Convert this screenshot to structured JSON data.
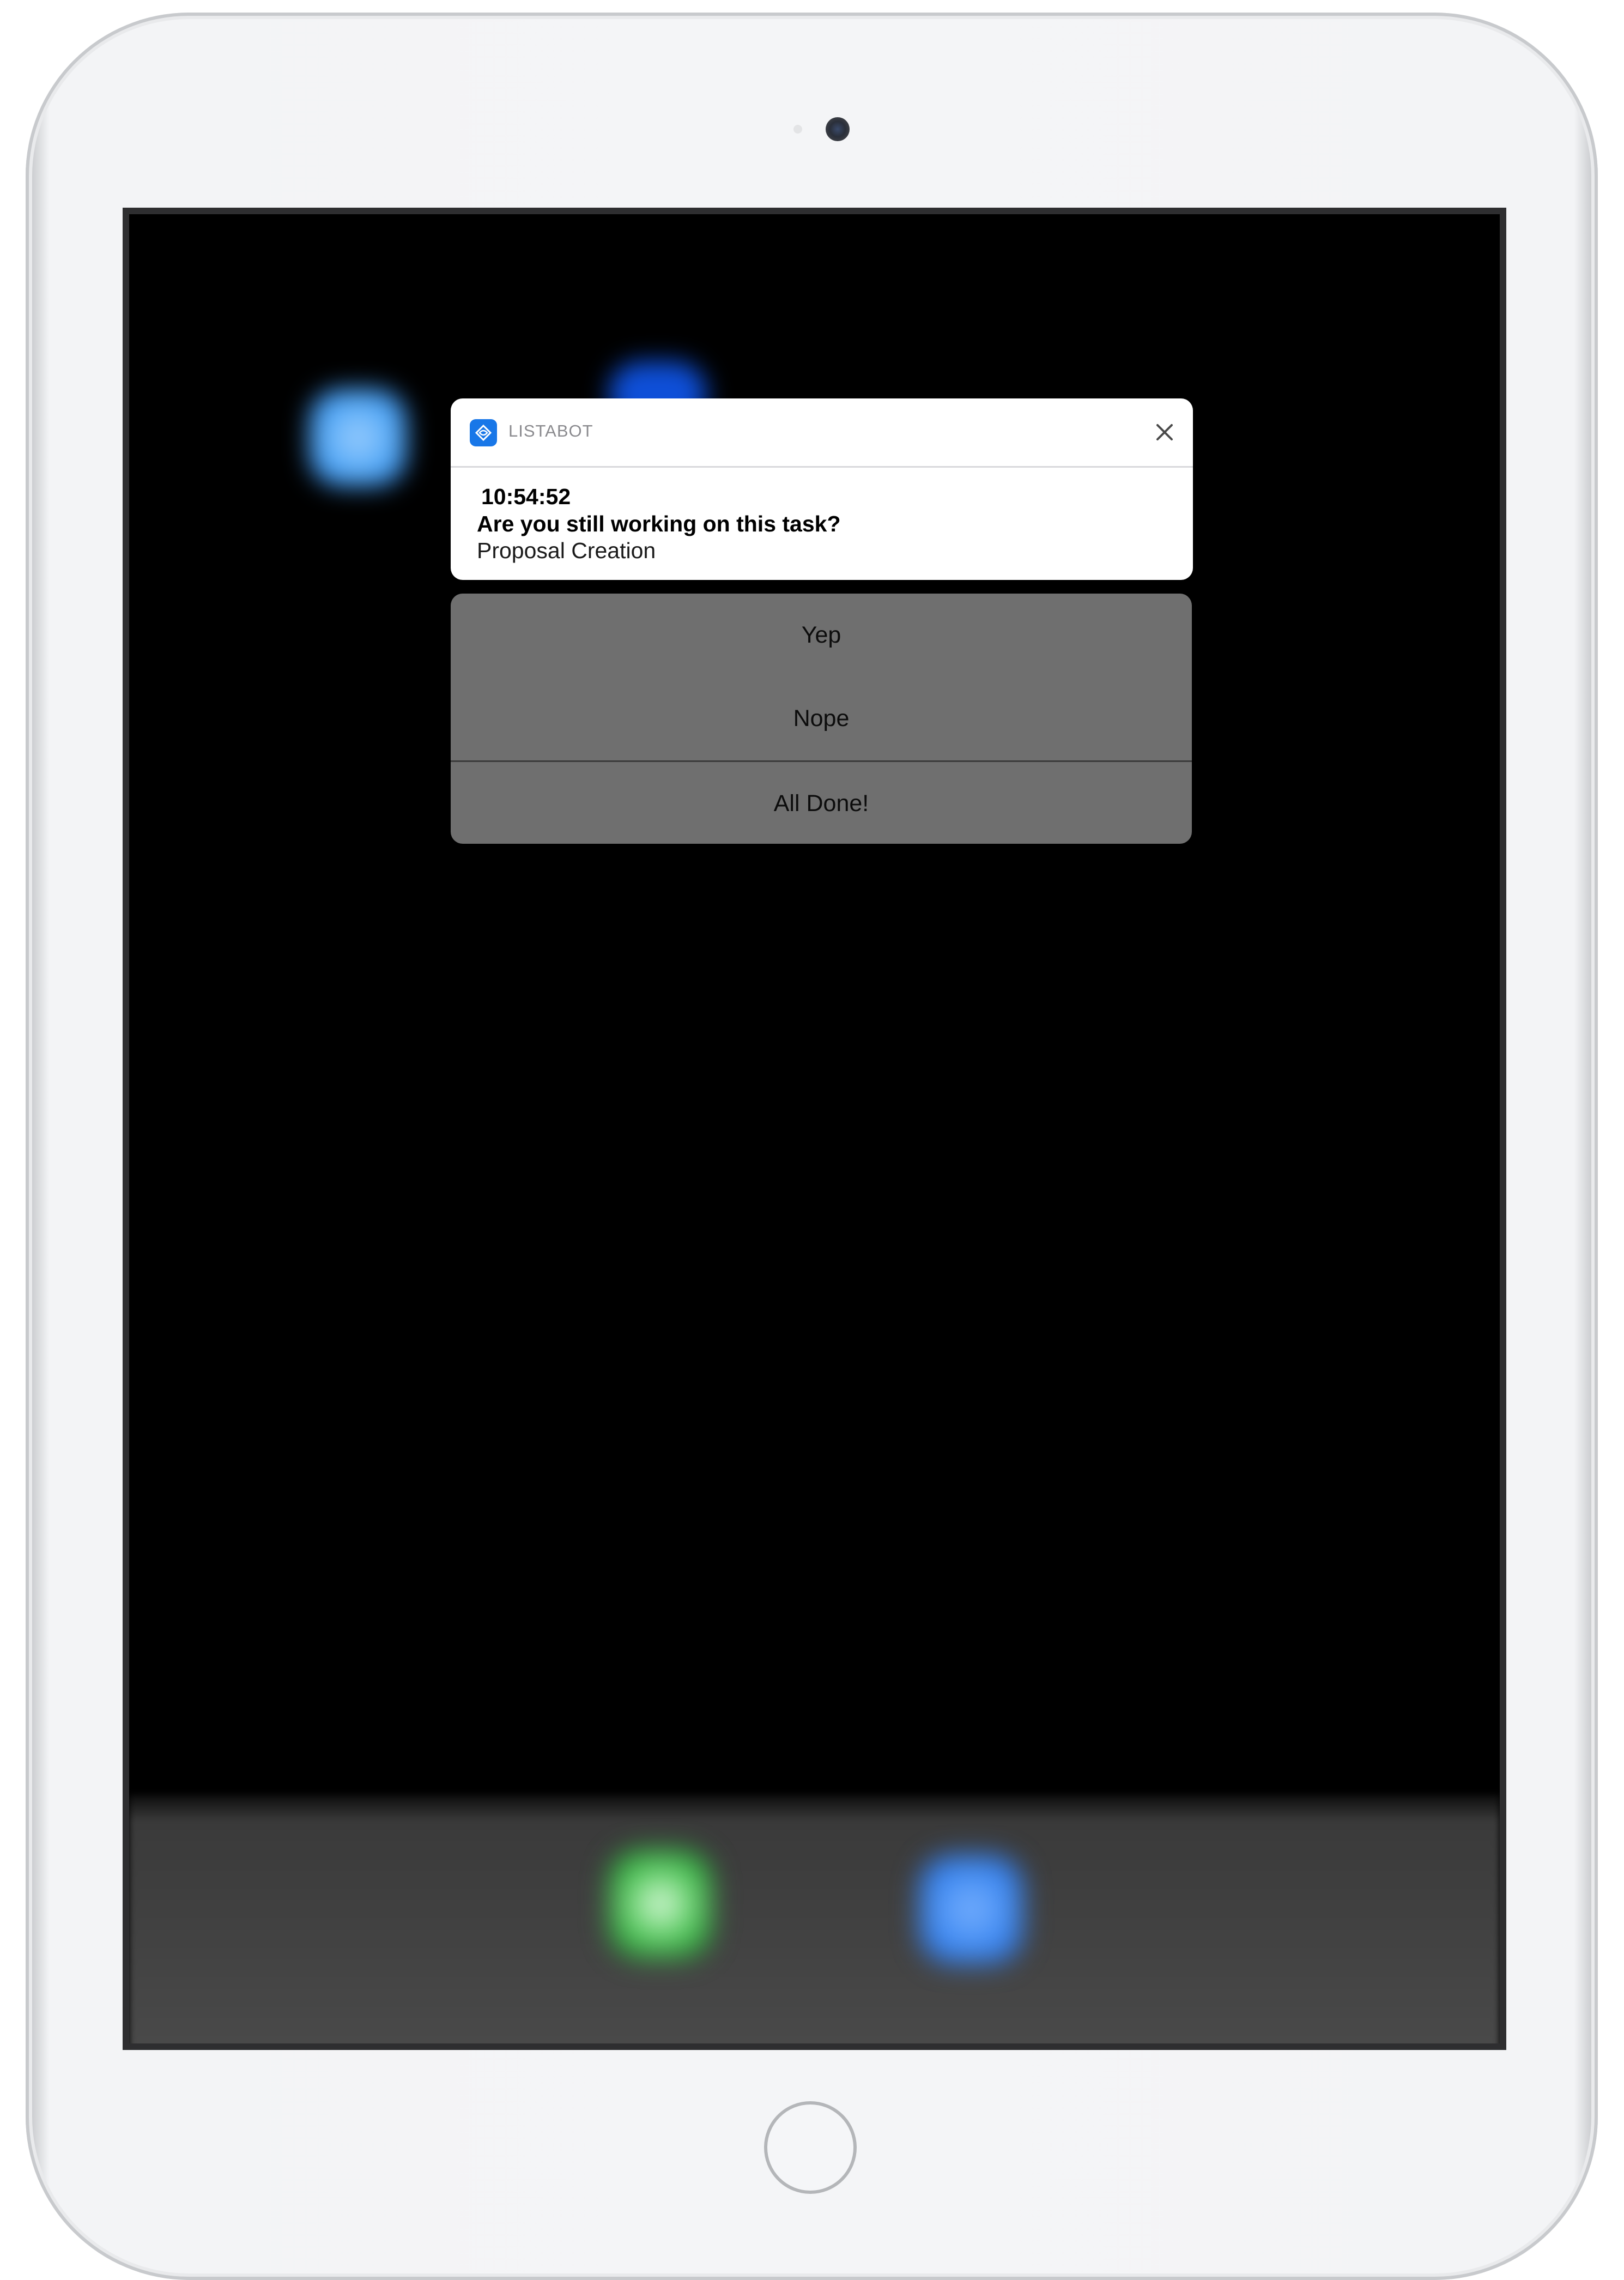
{
  "notification": {
    "app_name": "LISTABOT",
    "app_icon": "listabot-app-icon",
    "close_icon": "close-icon",
    "time": "10:54:52",
    "title": "Are you still working on this task?",
    "body": "Proposal Creation"
  },
  "actions": [
    {
      "label": "Yep"
    },
    {
      "label": "Nope"
    },
    {
      "label": "All Done!"
    }
  ],
  "colors": {
    "app_icon": "#1877E8",
    "action_sheet": "#6F6F6F",
    "screen_background": "#000000"
  }
}
